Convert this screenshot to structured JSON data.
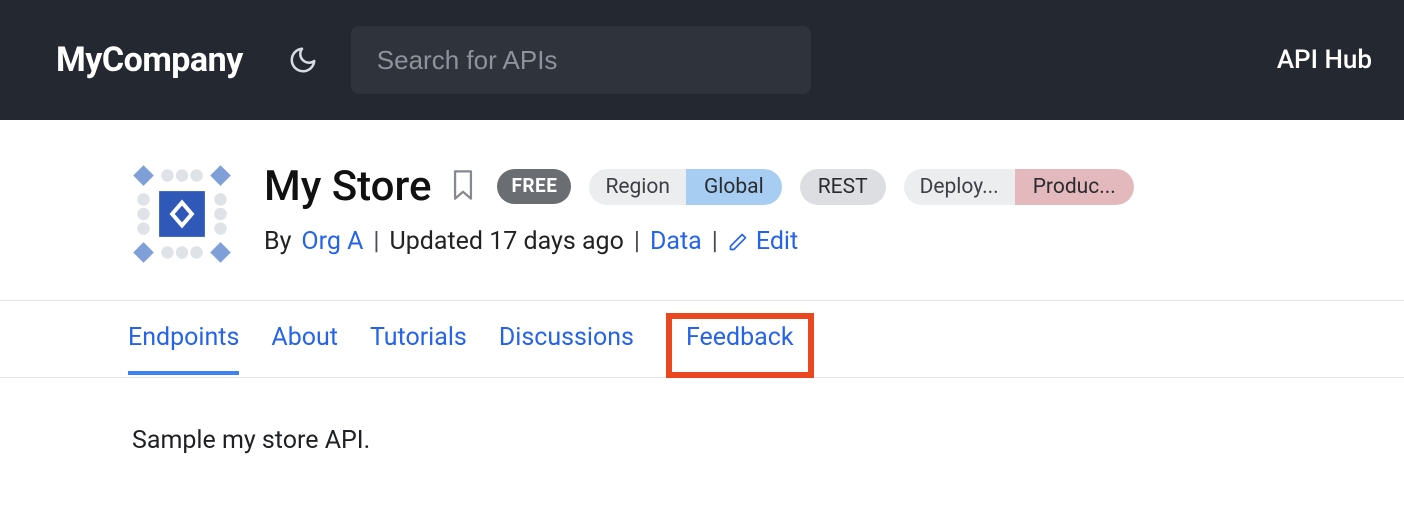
{
  "header": {
    "brand": "MyCompany",
    "search_placeholder": "Search for APIs",
    "hub_link": "API Hub"
  },
  "api": {
    "title": "My Store",
    "badge_free": "FREE",
    "region_label": "Region",
    "region_value": "Global",
    "rest_badge": "REST",
    "deploy_label": "Deploy...",
    "deploy_value": "Produc...",
    "meta": {
      "by_prefix": "By ",
      "org": "Org A",
      "updated": "Updated 17 days ago",
      "category": "Data",
      "edit": "Edit"
    }
  },
  "tabs": [
    {
      "id": "endpoints",
      "label": "Endpoints",
      "active": true
    },
    {
      "id": "about",
      "label": "About",
      "active": false
    },
    {
      "id": "tutorials",
      "label": "Tutorials",
      "active": false
    },
    {
      "id": "discussions",
      "label": "Discussions",
      "active": false
    },
    {
      "id": "feedback",
      "label": "Feedback",
      "active": false,
      "highlighted": true
    }
  ],
  "description": "Sample my store API."
}
